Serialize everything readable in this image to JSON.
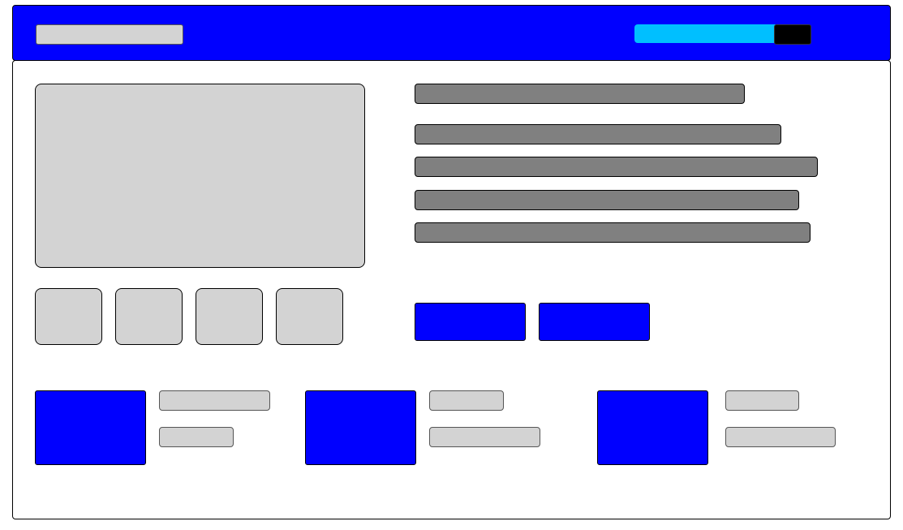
{
  "header": {
    "logo_text": "",
    "search": {
      "value": "",
      "placeholder": ""
    },
    "search_button_label": ""
  },
  "product": {
    "image_alt": "",
    "thumbnail_count": 4,
    "title": "",
    "description_lines": [
      "",
      "",
      "",
      ""
    ]
  },
  "actions": {
    "primary_label": "",
    "secondary_label": ""
  },
  "related": [
    {
      "title": "",
      "price": ""
    },
    {
      "title": "",
      "price": ""
    },
    {
      "title": "",
      "price": ""
    }
  ],
  "colors": {
    "primary": "#0000ff",
    "search_field": "#00bfff",
    "search_button": "#000000",
    "placeholder_light": "#d3d3d3",
    "placeholder_dark": "#808080",
    "background": "#ffffff"
  }
}
